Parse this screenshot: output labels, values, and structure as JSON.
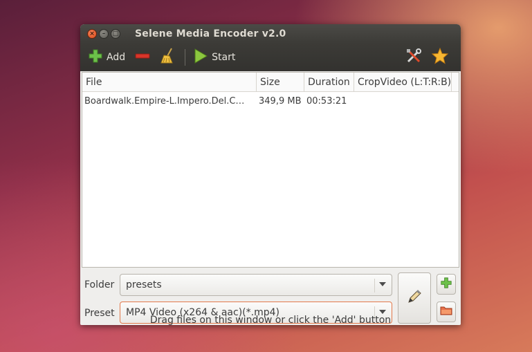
{
  "window": {
    "title": "Selene Media Encoder v2.0",
    "controls": {
      "close": "×",
      "minimize": "–",
      "maximize": "□"
    }
  },
  "toolbar": {
    "add_label": "Add",
    "start_label": "Start",
    "icons": [
      "add-icon",
      "remove-icon",
      "clear-broom-icon",
      "start-play-icon",
      "settings-tools-icon",
      "star-icon"
    ]
  },
  "file_list": {
    "columns": [
      "File",
      "Size",
      "Duration",
      "CropVideo (L:T:R:B)"
    ],
    "rows": [
      {
        "file": "Boardwalk.Empire-L.Impero.Del.C…",
        "size": "349,9 MB",
        "duration": "00:53:21",
        "crop": ""
      }
    ]
  },
  "form": {
    "folder_label": "Folder",
    "folder_value": "presets",
    "preset_label": "Preset",
    "preset_value": "MP4 Video (x264 & aac)(*.mp4)"
  },
  "status_text": "Drag files on this window or click the 'Add' button",
  "colors": {
    "accent_orange": "#e2784a",
    "add_green": "#6cc04a",
    "remove_red": "#d9352a"
  }
}
